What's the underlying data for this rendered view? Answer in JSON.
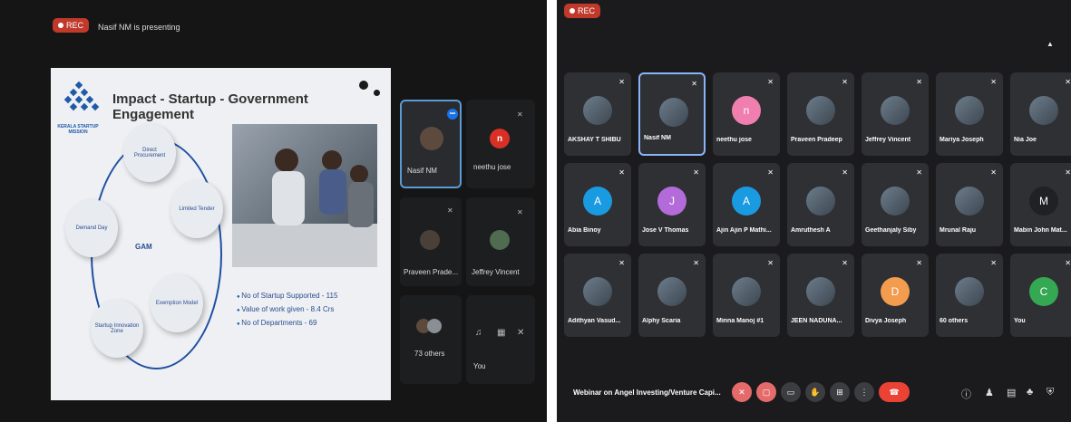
{
  "left_photo": {
    "rec_label": "REC",
    "presenting_text": "Nasif NM is presenting",
    "slide": {
      "title": "Impact - Startup - Government Engagement",
      "logo_text": "KERALA STARTUP MISSION",
      "center_label": "GAM",
      "cycle_items": [
        "Direct Procurement",
        "Limited Tender",
        "Exemption Model",
        "Startup Innovation Zone",
        "Demand Day"
      ],
      "bullets": [
        "No of Startup Supported - 115",
        "Value of work given - 8.4 Crs",
        "No of Departments - 69"
      ]
    },
    "tiles": [
      {
        "name": "Nasif NM",
        "badge": "•••"
      },
      {
        "name": "neethu jose",
        "initial": "n",
        "color": "#d93025"
      },
      {
        "name": "Praveen Prade...",
        "initial": ""
      },
      {
        "name": "Jeffrey Vincent",
        "initial": ""
      },
      {
        "name": "73 others",
        "initial": ""
      },
      {
        "name": "You",
        "initial": ""
      }
    ]
  },
  "right_photo": {
    "rec_label": "REC",
    "participants": [
      {
        "name": "AKSHAY T SHIBU",
        "initial": "",
        "color": ""
      },
      {
        "name": "Nasif NM",
        "initial": "",
        "color": ""
      },
      {
        "name": "neethu jose",
        "initial": "n",
        "color": "#f07fb0"
      },
      {
        "name": "Praveen Pradeep",
        "initial": "",
        "color": ""
      },
      {
        "name": "Jeffrey Vincent",
        "initial": "",
        "color": ""
      },
      {
        "name": "Mariya Joseph",
        "initial": "",
        "color": ""
      },
      {
        "name": "Nia Joe",
        "initial": "",
        "color": ""
      },
      {
        "name": "Abia Binoy",
        "initial": "A",
        "color": "#1a9ae0"
      },
      {
        "name": "Jose V Thomas",
        "initial": "J",
        "color": "#b36bd9"
      },
      {
        "name": "Ajin Ajin P Mathi...",
        "initial": "A",
        "color": "#1a9ae0"
      },
      {
        "name": "Amruthesh A",
        "initial": "",
        "color": ""
      },
      {
        "name": "Geethanjaly Siby",
        "initial": "",
        "color": ""
      },
      {
        "name": "Mrunal Raju",
        "initial": "",
        "color": ""
      },
      {
        "name": "Mabin John Mat...",
        "initial": "M",
        "color": "#202124"
      },
      {
        "name": "Adithyan Vasud...",
        "initial": "",
        "color": ""
      },
      {
        "name": "Alphy Scaria",
        "initial": "",
        "color": ""
      },
      {
        "name": "Minna Manoj #1",
        "initial": "",
        "color": ""
      },
      {
        "name": "JEEN NADUNA...",
        "initial": "",
        "color": ""
      },
      {
        "name": "Divya Joseph",
        "initial": "D",
        "color": "#f39c4f"
      },
      {
        "name": "60 others",
        "initial": "",
        "color": ""
      },
      {
        "name": "You",
        "initial": "C",
        "color": "#34a853"
      }
    ],
    "meeting_title": "Webinar on Angel Investing/Venture Capi..."
  }
}
